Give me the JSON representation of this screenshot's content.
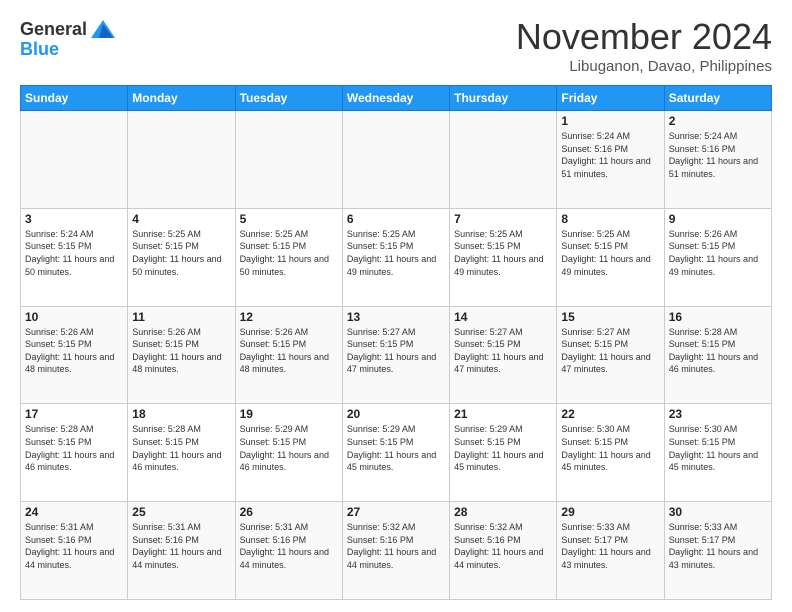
{
  "header": {
    "logo_general": "General",
    "logo_blue": "Blue",
    "month_title": "November 2024",
    "location": "Libuganon, Davao, Philippines"
  },
  "calendar": {
    "days_of_week": [
      "Sunday",
      "Monday",
      "Tuesday",
      "Wednesday",
      "Thursday",
      "Friday",
      "Saturday"
    ],
    "weeks": [
      [
        {
          "day": "",
          "empty": true
        },
        {
          "day": "",
          "empty": true
        },
        {
          "day": "",
          "empty": true
        },
        {
          "day": "",
          "empty": true
        },
        {
          "day": "",
          "empty": true
        },
        {
          "day": "1",
          "sunrise": "5:24 AM",
          "sunset": "5:16 PM",
          "daylight": "11 hours and 51 minutes."
        },
        {
          "day": "2",
          "sunrise": "5:24 AM",
          "sunset": "5:16 PM",
          "daylight": "11 hours and 51 minutes."
        }
      ],
      [
        {
          "day": "3",
          "sunrise": "5:24 AM",
          "sunset": "5:15 PM",
          "daylight": "11 hours and 50 minutes."
        },
        {
          "day": "4",
          "sunrise": "5:25 AM",
          "sunset": "5:15 PM",
          "daylight": "11 hours and 50 minutes."
        },
        {
          "day": "5",
          "sunrise": "5:25 AM",
          "sunset": "5:15 PM",
          "daylight": "11 hours and 50 minutes."
        },
        {
          "day": "6",
          "sunrise": "5:25 AM",
          "sunset": "5:15 PM",
          "daylight": "11 hours and 49 minutes."
        },
        {
          "day": "7",
          "sunrise": "5:25 AM",
          "sunset": "5:15 PM",
          "daylight": "11 hours and 49 minutes."
        },
        {
          "day": "8",
          "sunrise": "5:25 AM",
          "sunset": "5:15 PM",
          "daylight": "11 hours and 49 minutes."
        },
        {
          "day": "9",
          "sunrise": "5:26 AM",
          "sunset": "5:15 PM",
          "daylight": "11 hours and 49 minutes."
        }
      ],
      [
        {
          "day": "10",
          "sunrise": "5:26 AM",
          "sunset": "5:15 PM",
          "daylight": "11 hours and 48 minutes."
        },
        {
          "day": "11",
          "sunrise": "5:26 AM",
          "sunset": "5:15 PM",
          "daylight": "11 hours and 48 minutes."
        },
        {
          "day": "12",
          "sunrise": "5:26 AM",
          "sunset": "5:15 PM",
          "daylight": "11 hours and 48 minutes."
        },
        {
          "day": "13",
          "sunrise": "5:27 AM",
          "sunset": "5:15 PM",
          "daylight": "11 hours and 47 minutes."
        },
        {
          "day": "14",
          "sunrise": "5:27 AM",
          "sunset": "5:15 PM",
          "daylight": "11 hours and 47 minutes."
        },
        {
          "day": "15",
          "sunrise": "5:27 AM",
          "sunset": "5:15 PM",
          "daylight": "11 hours and 47 minutes."
        },
        {
          "day": "16",
          "sunrise": "5:28 AM",
          "sunset": "5:15 PM",
          "daylight": "11 hours and 46 minutes."
        }
      ],
      [
        {
          "day": "17",
          "sunrise": "5:28 AM",
          "sunset": "5:15 PM",
          "daylight": "11 hours and 46 minutes."
        },
        {
          "day": "18",
          "sunrise": "5:28 AM",
          "sunset": "5:15 PM",
          "daylight": "11 hours and 46 minutes."
        },
        {
          "day": "19",
          "sunrise": "5:29 AM",
          "sunset": "5:15 PM",
          "daylight": "11 hours and 46 minutes."
        },
        {
          "day": "20",
          "sunrise": "5:29 AM",
          "sunset": "5:15 PM",
          "daylight": "11 hours and 45 minutes."
        },
        {
          "day": "21",
          "sunrise": "5:29 AM",
          "sunset": "5:15 PM",
          "daylight": "11 hours and 45 minutes."
        },
        {
          "day": "22",
          "sunrise": "5:30 AM",
          "sunset": "5:15 PM",
          "daylight": "11 hours and 45 minutes."
        },
        {
          "day": "23",
          "sunrise": "5:30 AM",
          "sunset": "5:15 PM",
          "daylight": "11 hours and 45 minutes."
        }
      ],
      [
        {
          "day": "24",
          "sunrise": "5:31 AM",
          "sunset": "5:16 PM",
          "daylight": "11 hours and 44 minutes."
        },
        {
          "day": "25",
          "sunrise": "5:31 AM",
          "sunset": "5:16 PM",
          "daylight": "11 hours and 44 minutes."
        },
        {
          "day": "26",
          "sunrise": "5:31 AM",
          "sunset": "5:16 PM",
          "daylight": "11 hours and 44 minutes."
        },
        {
          "day": "27",
          "sunrise": "5:32 AM",
          "sunset": "5:16 PM",
          "daylight": "11 hours and 44 minutes."
        },
        {
          "day": "28",
          "sunrise": "5:32 AM",
          "sunset": "5:16 PM",
          "daylight": "11 hours and 44 minutes."
        },
        {
          "day": "29",
          "sunrise": "5:33 AM",
          "sunset": "5:17 PM",
          "daylight": "11 hours and 43 minutes."
        },
        {
          "day": "30",
          "sunrise": "5:33 AM",
          "sunset": "5:17 PM",
          "daylight": "11 hours and 43 minutes."
        }
      ]
    ]
  }
}
